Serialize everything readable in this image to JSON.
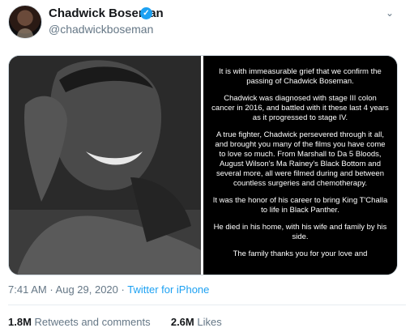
{
  "author": {
    "name": "Chadwick Boseman",
    "handle": "@chadwickboseman",
    "verified_icon": "✓",
    "menu_icon": "⌄"
  },
  "statement": {
    "paragraphs": [
      "It is with immeasurable grief that we confirm the passing of Chadwick Boseman.",
      "Chadwick was diagnosed with stage III colon cancer in 2016, and battled with it these last 4 years as it progressed to stage IV.",
      "A true fighter, Chadwick persevered through it all, and brought you many of the films you have come to love so much. From Marshall to Da 5 Bloods, August Wilson's Ma Rainey's Black Bottom and several more, all were filmed during and between countless surgeries and chemotherapy.",
      "It was the honor of his career to bring King T'Challa to life in Black Panther.",
      "He died in his home, with his wife and family by his side.",
      "The family thanks you for your love and"
    ]
  },
  "meta": {
    "time": "7:41 AM",
    "separator": " · ",
    "date": "Aug 29, 2020",
    "source": "Twitter for iPhone"
  },
  "stats": {
    "retweets_count": "1.8M",
    "retweets_label": " Retweets and comments",
    "likes_count": "2.6M",
    "likes_label": " Likes"
  }
}
